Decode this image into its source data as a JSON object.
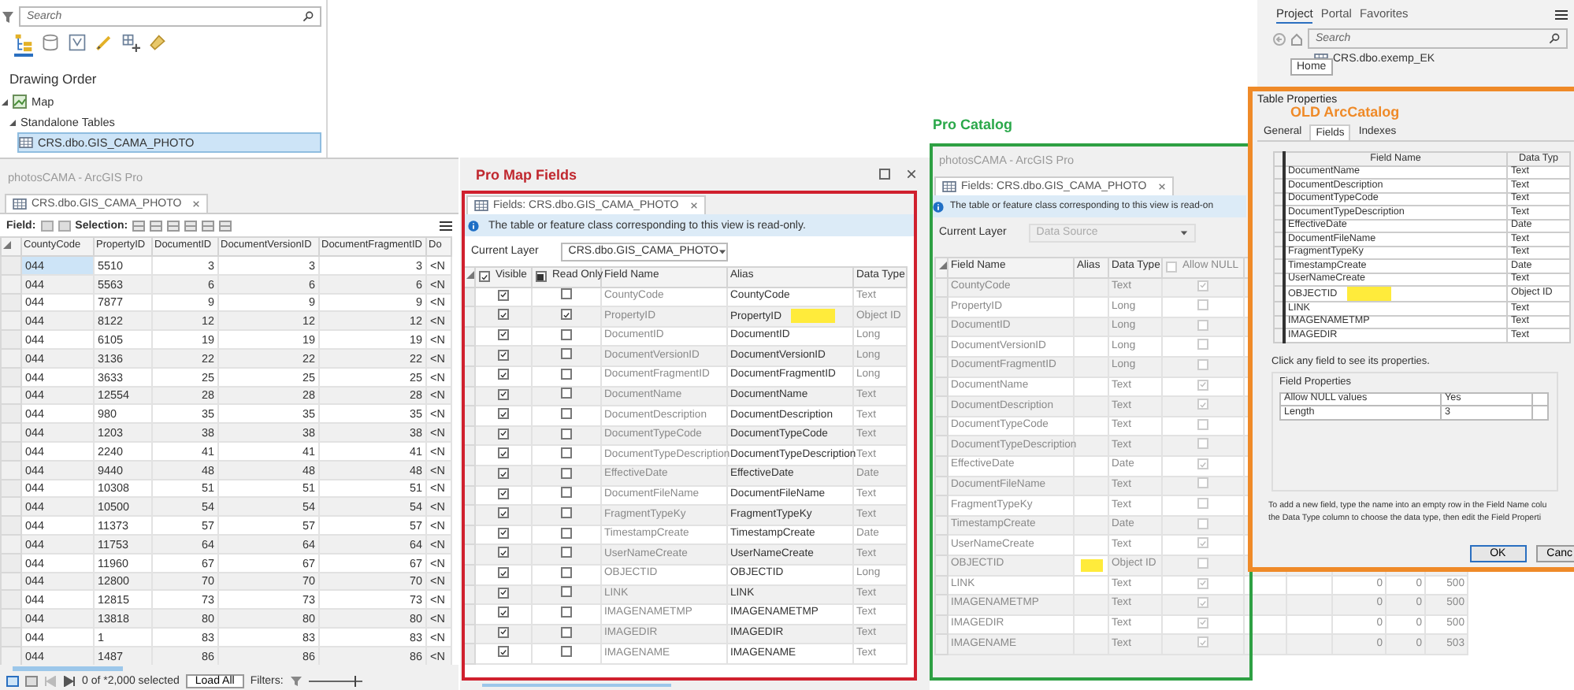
{
  "contents_pane": {
    "search": {
      "placeholder": "Search"
    },
    "view_tabs": [
      {
        "selected": true
      },
      {
        "selected": false
      },
      {
        "selected": false
      },
      {
        "selected": false
      },
      {
        "selected": false
      },
      {
        "selected": false
      }
    ],
    "heading": "Drawing Order",
    "tree": [
      {
        "label": "Map",
        "kind": "map",
        "expanded": true,
        "selected": false,
        "children": [
          {
            "label": "Standalone Tables",
            "expanded": true,
            "selected": false,
            "children": [
              {
                "label": "CRS.dbo.GIS_CAMA_PHOTO",
                "kind": "table",
                "selected": true
              }
            ]
          }
        ]
      }
    ]
  },
  "attribute_window": {
    "title": "photosCAMA - ArcGIS Pro",
    "tab": "CRS.dbo.GIS_CAMA_PHOTO",
    "field_label": "Field:",
    "selection_label": "Selection:",
    "columns": [
      "CountyCode",
      "PropertyID",
      "DocumentID",
      "DocumentVersionID",
      "DocumentFragmentID",
      "Do"
    ],
    "rows": [
      {
        "selected": true,
        "cells": [
          "044",
          "5510",
          "3",
          "3",
          "3",
          "<N"
        ]
      },
      {
        "selected": false,
        "cells": [
          "044",
          "5563",
          "6",
          "6",
          "6",
          "<N"
        ]
      },
      {
        "selected": false,
        "cells": [
          "044",
          "7877",
          "9",
          "9",
          "9",
          "<N"
        ]
      },
      {
        "selected": false,
        "cells": [
          "044",
          "8122",
          "12",
          "12",
          "12",
          "<N"
        ]
      },
      {
        "selected": false,
        "cells": [
          "044",
          "6105",
          "19",
          "19",
          "19",
          "<N"
        ]
      },
      {
        "selected": false,
        "cells": [
          "044",
          "3136",
          "22",
          "22",
          "22",
          "<N"
        ]
      },
      {
        "selected": false,
        "cells": [
          "044",
          "3633",
          "25",
          "25",
          "25",
          "<N"
        ]
      },
      {
        "selected": false,
        "cells": [
          "044",
          "12554",
          "28",
          "28",
          "28",
          "<N"
        ]
      },
      {
        "selected": false,
        "cells": [
          "044",
          "980",
          "35",
          "35",
          "35",
          "<N"
        ]
      },
      {
        "selected": false,
        "cells": [
          "044",
          "1203",
          "38",
          "38",
          "38",
          "<N"
        ]
      },
      {
        "selected": false,
        "cells": [
          "044",
          "2240",
          "41",
          "41",
          "41",
          "<N"
        ]
      },
      {
        "selected": false,
        "cells": [
          "044",
          "9440",
          "48",
          "48",
          "48",
          "<N"
        ]
      },
      {
        "selected": false,
        "cells": [
          "044",
          "10308",
          "51",
          "51",
          "51",
          "<N"
        ]
      },
      {
        "selected": false,
        "cells": [
          "044",
          "10500",
          "54",
          "54",
          "54",
          "<N"
        ]
      },
      {
        "selected": false,
        "cells": [
          "044",
          "11373",
          "57",
          "57",
          "57",
          "<N"
        ]
      },
      {
        "selected": false,
        "cells": [
          "044",
          "11753",
          "64",
          "64",
          "64",
          "<N"
        ]
      },
      {
        "selected": false,
        "cells": [
          "044",
          "11960",
          "67",
          "67",
          "67",
          "<N"
        ]
      },
      {
        "selected": false,
        "cells": [
          "044",
          "12800",
          "70",
          "70",
          "70",
          "<N"
        ]
      },
      {
        "selected": false,
        "cells": [
          "044",
          "12815",
          "73",
          "73",
          "73",
          "<N"
        ]
      },
      {
        "selected": false,
        "cells": [
          "044",
          "13818",
          "80",
          "80",
          "80",
          "<N"
        ]
      },
      {
        "selected": false,
        "cells": [
          "044",
          "1",
          "83",
          "83",
          "83",
          "<N"
        ]
      },
      {
        "selected": false,
        "cells": [
          "044",
          "1487",
          "86",
          "86",
          "86",
          "<N"
        ]
      }
    ],
    "status": "0 of *2,000 selected",
    "load_all": "Load All",
    "filters": "Filters:",
    "zoom_slider": {
      "level": 0.85
    }
  },
  "map_fields": {
    "annotation": "Pro Map Fields",
    "tab": "Fields: CRS.dbo.GIS_CAMA_PHOTO",
    "info": "The table or feature class corresponding to this view is read-only.",
    "current_layer_label": "Current Layer",
    "current_layer": {
      "value": "CRS.dbo.GIS_CAMA_PHOTO",
      "disabled": false
    },
    "columns": [
      {
        "label": "Visible",
        "kind": "check",
        "checked": true,
        "indeterminate": false
      },
      {
        "label": "Read Only",
        "kind": "check",
        "checked": false,
        "indeterminate": true
      },
      {
        "label": "Field Name",
        "kind": "text"
      },
      {
        "label": "Alias",
        "kind": "text"
      },
      {
        "label": "Data Type",
        "kind": "text"
      }
    ],
    "rows": [
      {
        "visible": true,
        "read_only": false,
        "field_name": "CountyCode",
        "alias": "CountyCode",
        "data_type": "Text",
        "highlighted": false
      },
      {
        "visible": true,
        "read_only": true,
        "field_name": "PropertyID",
        "alias": "PropertyID",
        "data_type": "Object ID",
        "highlighted": true
      },
      {
        "visible": true,
        "read_only": false,
        "field_name": "DocumentID",
        "alias": "DocumentID",
        "data_type": "Long",
        "highlighted": false
      },
      {
        "visible": true,
        "read_only": false,
        "field_name": "DocumentVersionID",
        "alias": "DocumentVersionID",
        "data_type": "Long",
        "highlighted": false
      },
      {
        "visible": true,
        "read_only": false,
        "field_name": "DocumentFragmentID",
        "alias": "DocumentFragmentID",
        "data_type": "Long",
        "highlighted": false
      },
      {
        "visible": true,
        "read_only": false,
        "field_name": "DocumentName",
        "alias": "DocumentName",
        "data_type": "Text",
        "highlighted": false
      },
      {
        "visible": true,
        "read_only": false,
        "field_name": "DocumentDescription",
        "alias": "DocumentDescription",
        "data_type": "Text",
        "highlighted": false
      },
      {
        "visible": true,
        "read_only": false,
        "field_name": "DocumentTypeCode",
        "alias": "DocumentTypeCode",
        "data_type": "Text",
        "highlighted": false
      },
      {
        "visible": true,
        "read_only": false,
        "field_name": "DocumentTypeDescription",
        "alias": "DocumentTypeDescription",
        "data_type": "Text",
        "highlighted": false
      },
      {
        "visible": true,
        "read_only": false,
        "field_name": "EffectiveDate",
        "alias": "EffectiveDate",
        "data_type": "Date",
        "highlighted": false
      },
      {
        "visible": true,
        "read_only": false,
        "field_name": "DocumentFileName",
        "alias": "DocumentFileName",
        "data_type": "Text",
        "highlighted": false
      },
      {
        "visible": true,
        "read_only": false,
        "field_name": "FragmentTypeKy",
        "alias": "FragmentTypeKy",
        "data_type": "Text",
        "highlighted": false
      },
      {
        "visible": true,
        "read_only": false,
        "field_name": "TimestampCreate",
        "alias": "TimestampCreate",
        "data_type": "Date",
        "highlighted": false
      },
      {
        "visible": true,
        "read_only": false,
        "field_name": "UserNameCreate",
        "alias": "UserNameCreate",
        "data_type": "Text",
        "highlighted": false
      },
      {
        "visible": true,
        "read_only": false,
        "field_name": "OBJECTID",
        "alias": "OBJECTID",
        "data_type": "Long",
        "highlighted": false
      },
      {
        "visible": true,
        "read_only": false,
        "field_name": "LINK",
        "alias": "LINK",
        "data_type": "Text",
        "highlighted": false
      },
      {
        "visible": true,
        "read_only": false,
        "field_name": "IMAGENAMETMP",
        "alias": "IMAGENAMETMP",
        "data_type": "Text",
        "highlighted": false
      },
      {
        "visible": true,
        "read_only": false,
        "field_name": "IMAGEDIR",
        "alias": "IMAGEDIR",
        "data_type": "Text",
        "highlighted": false
      },
      {
        "visible": true,
        "read_only": false,
        "field_name": "IMAGENAME",
        "alias": "IMAGENAME",
        "data_type": "Text",
        "highlighted": false
      }
    ]
  },
  "catalog": {
    "annotation": "Pro Catalog",
    "title": "photosCAMA - ArcGIS Pro",
    "tab": "Fields: CRS.dbo.GIS_CAMA_PHOTO",
    "info": "The table or feature class corresponding to this view is read-on",
    "current_layer_label": "Current Layer",
    "current_layer": {
      "value": "Data Source",
      "disabled": true
    },
    "columns": [
      {
        "label": "Field Name",
        "kind": "text"
      },
      {
        "label": "Alias",
        "kind": "text"
      },
      {
        "label": "Data Type",
        "kind": "text"
      },
      {
        "label": "Allow NULL",
        "kind": "check",
        "checked": false,
        "indeterminate": false
      }
    ],
    "rows": [
      {
        "field_name": "CountyCode",
        "data_type": "Text",
        "allow_null": true,
        "highlighted": false
      },
      {
        "field_name": "PropertyID",
        "data_type": "Long",
        "allow_null": false,
        "highlighted": false
      },
      {
        "field_name": "DocumentID",
        "data_type": "Long",
        "allow_null": false,
        "highlighted": false
      },
      {
        "field_name": "DocumentVersionID",
        "data_type": "Long",
        "allow_null": false,
        "highlighted": false
      },
      {
        "field_name": "DocumentFragmentID",
        "data_type": "Long",
        "allow_null": false,
        "highlighted": false
      },
      {
        "field_name": "DocumentName",
        "data_type": "Text",
        "allow_null": true,
        "highlighted": false
      },
      {
        "field_name": "DocumentDescription",
        "data_type": "Text",
        "allow_null": true,
        "highlighted": false
      },
      {
        "field_name": "DocumentTypeCode",
        "data_type": "Text",
        "allow_null": false,
        "highlighted": false
      },
      {
        "field_name": "DocumentTypeDescription",
        "data_type": "Text",
        "allow_null": false,
        "highlighted": false
      },
      {
        "field_name": "EffectiveDate",
        "data_type": "Date",
        "allow_null": true,
        "highlighted": false
      },
      {
        "field_name": "DocumentFileName",
        "data_type": "Text",
        "allow_null": false,
        "highlighted": false
      },
      {
        "field_name": "FragmentTypeKy",
        "data_type": "Text",
        "allow_null": false,
        "highlighted": false
      },
      {
        "field_name": "TimestampCreate",
        "data_type": "Date",
        "allow_null": false,
        "highlighted": false
      },
      {
        "field_name": "UserNameCreate",
        "data_type": "Text",
        "allow_null": true,
        "highlighted": false
      },
      {
        "field_name": "OBJECTID",
        "data_type": "Object ID",
        "allow_null": false,
        "highlighted": true
      },
      {
        "field_name": "LINK",
        "data_type": "Text",
        "allow_null": true,
        "highlighted": false,
        "extra": [
          "0",
          "0",
          "500"
        ]
      },
      {
        "field_name": "IMAGENAMETMP",
        "data_type": "Text",
        "allow_null": true,
        "highlighted": false,
        "extra": [
          "0",
          "0",
          "500"
        ]
      },
      {
        "field_name": "IMAGEDIR",
        "data_type": "Text",
        "allow_null": true,
        "highlighted": false,
        "extra": [
          "0",
          "0",
          "500"
        ]
      },
      {
        "field_name": "IMAGENAME",
        "data_type": "Text",
        "allow_null": true,
        "highlighted": false,
        "extra": [
          "0",
          "0",
          "503"
        ]
      }
    ]
  },
  "catalog_browser": {
    "tabs": [
      {
        "label": "Project",
        "selected": true
      },
      {
        "label": "Portal",
        "selected": false
      },
      {
        "label": "Favorites",
        "selected": false
      }
    ],
    "search": {
      "placeholder": "Search"
    },
    "item": "CRS.dbo.exemp_EK",
    "tooltip": "Home"
  },
  "old_arccatalog": {
    "title": "Table Properties",
    "annotation": "OLD ArcCatalog",
    "tabs": [
      {
        "label": "General",
        "selected": false
      },
      {
        "label": "Fields",
        "selected": true
      },
      {
        "label": "Indexes",
        "selected": false
      }
    ],
    "columns": [
      "Field Name",
      "Data Typ"
    ],
    "rows": [
      {
        "field_name": "DocumentName",
        "data_type": "Text",
        "highlighted": false
      },
      {
        "field_name": "DocumentDescription",
        "data_type": "Text",
        "highlighted": false
      },
      {
        "field_name": "DocumentTypeCode",
        "data_type": "Text",
        "highlighted": false
      },
      {
        "field_name": "DocumentTypeDescription",
        "data_type": "Text",
        "highlighted": false
      },
      {
        "field_name": "EffectiveDate",
        "data_type": "Date",
        "highlighted": false
      },
      {
        "field_name": "DocumentFileName",
        "data_type": "Text",
        "highlighted": false
      },
      {
        "field_name": "FragmentTypeKy",
        "data_type": "Text",
        "highlighted": false
      },
      {
        "field_name": "TimestampCreate",
        "data_type": "Date",
        "highlighted": false
      },
      {
        "field_name": "UserNameCreate",
        "data_type": "Text",
        "highlighted": false
      },
      {
        "field_name": "OBJECTID",
        "data_type": "Object ID",
        "highlighted": true
      },
      {
        "field_name": "LINK",
        "data_type": "Text",
        "highlighted": false
      },
      {
        "field_name": "IMAGENAMETMP",
        "data_type": "Text",
        "highlighted": false
      },
      {
        "field_name": "IMAGEDIR",
        "data_type": "Text",
        "highlighted": false
      }
    ],
    "hint": "Click any field to see its properties.",
    "properties_title": "Field Properties",
    "properties": [
      {
        "name": "Allow NULL values",
        "value": "Yes"
      },
      {
        "name": "Length",
        "value": "3"
      }
    ],
    "help": [
      "To add a new field, type the name into an empty row in the Field Name colu",
      "the Data Type column to choose the data type, then edit the Field Properti"
    ],
    "buttons": [
      "OK",
      "Canc"
    ]
  }
}
